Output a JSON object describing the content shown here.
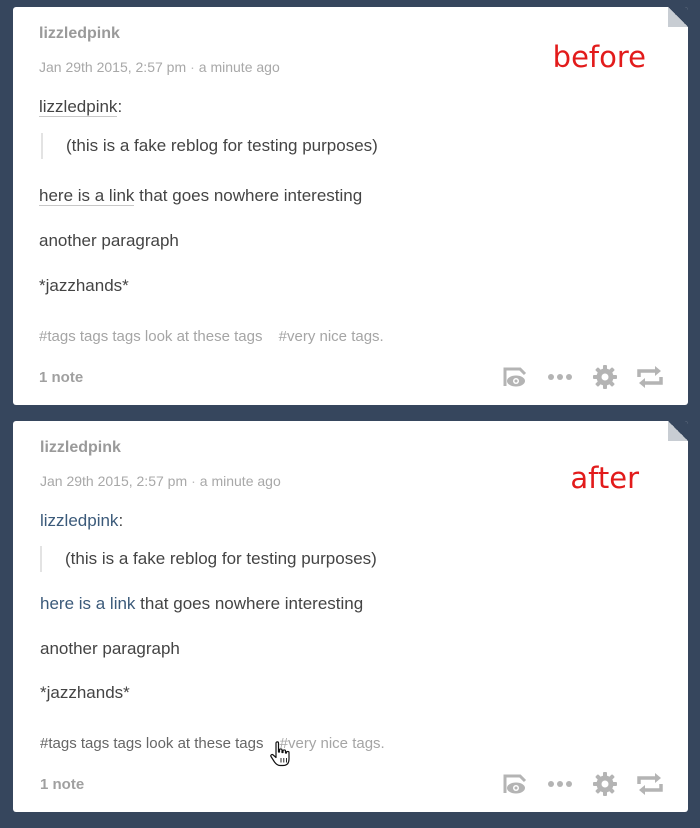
{
  "posts": [
    {
      "annotation": "before",
      "blog_name": "lizzledpink",
      "date": "Jan 29th 2015, 2:57 pm",
      "separator": "·",
      "relative_time": "a minute ago",
      "reblog_source": "lizzledpink",
      "reblog_colon": ":",
      "quote": "(this is a fake reblog for testing purposes)",
      "link_text": "here is a link",
      "link_rest": " that goes nowhere interesting",
      "paragraph": "another paragraph",
      "jazzhands": "*jazzhands*",
      "tags": [
        "#tags tags tags look at these tags",
        "#very nice tags."
      ],
      "notes": "1 note",
      "icons": [
        "reblog-view-icon",
        "more-icon",
        "gear-icon",
        "reblog-icon"
      ]
    },
    {
      "annotation": "after",
      "blog_name": "lizzledpink",
      "date": "Jan 29th 2015, 2:57 pm",
      "separator": "·",
      "relative_time": "a minute ago",
      "reblog_source": "lizzledpink",
      "reblog_colon": ":",
      "quote": "(this is a fake reblog for testing purposes)",
      "link_text": "here is a link",
      "link_rest": " that goes nowhere interesting",
      "paragraph": "another paragraph",
      "jazzhands": "*jazzhands*",
      "tags": [
        "#tags tags tags look at these tags",
        "#very nice tags."
      ],
      "notes": "1 note",
      "icons": [
        "reblog-view-icon",
        "more-icon",
        "gear-icon",
        "reblog-icon"
      ]
    }
  ],
  "colors": {
    "background": "#36465d",
    "annotation": "#e21b1b",
    "link_after": "#3b5a7a"
  }
}
